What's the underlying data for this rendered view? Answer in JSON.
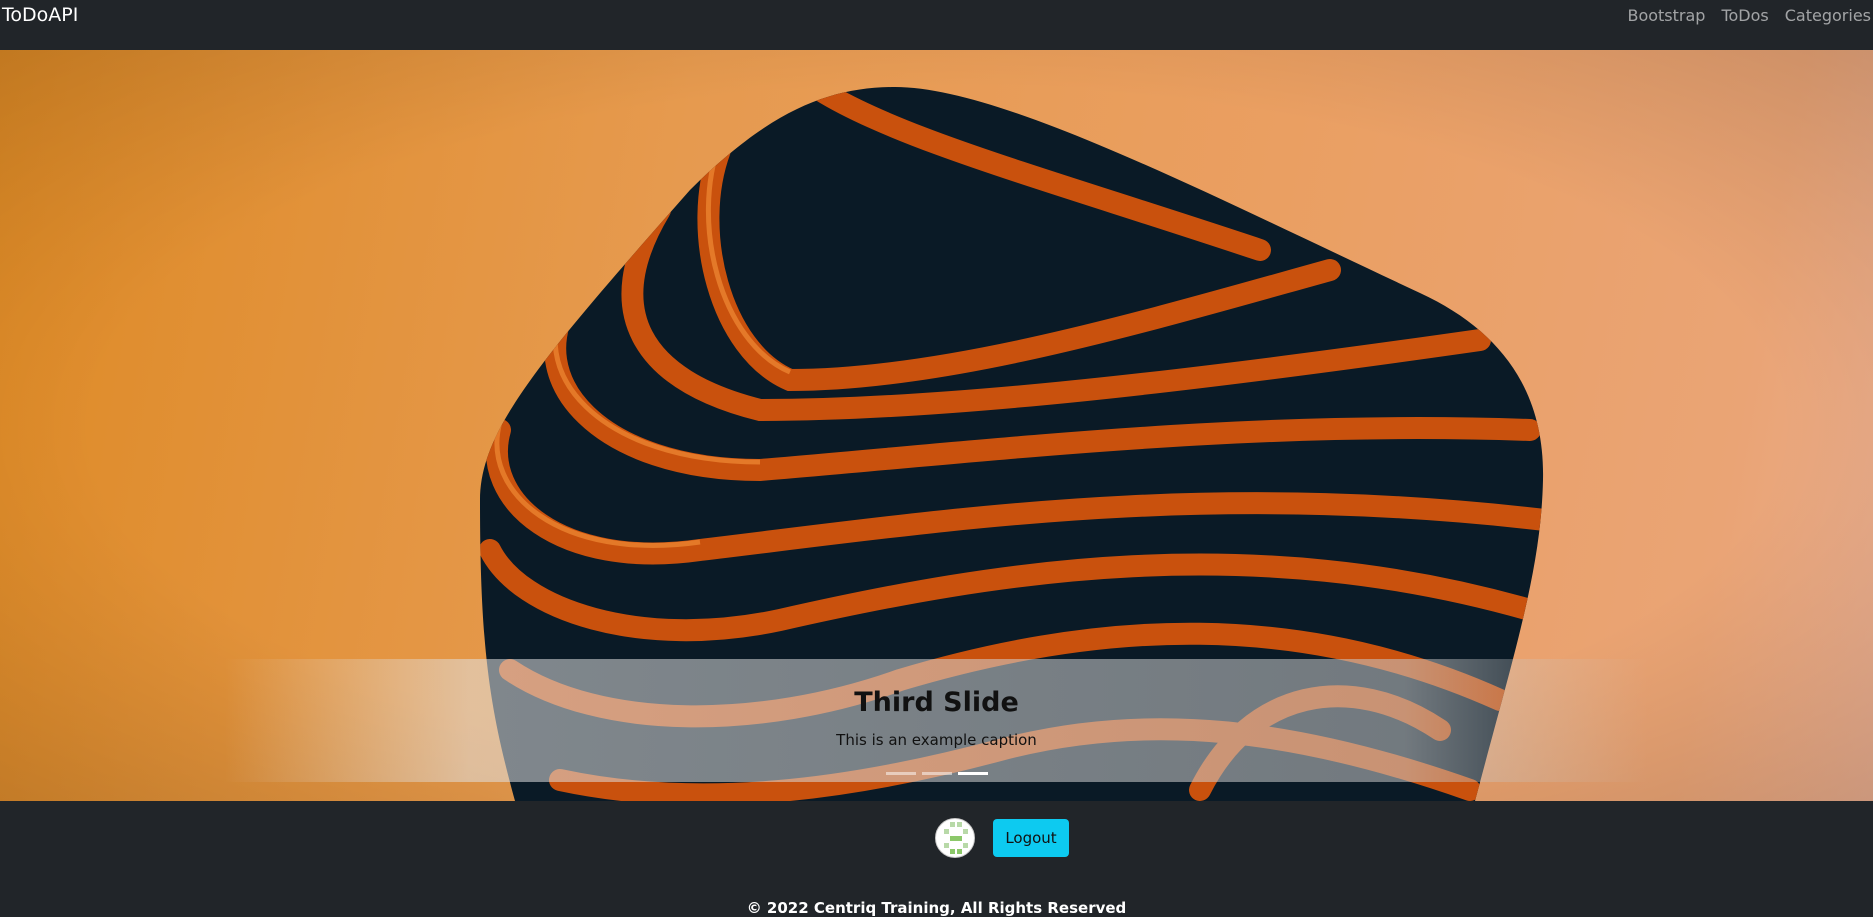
{
  "navbar": {
    "brand": "ToDoAPI",
    "links": [
      {
        "label": "Bootstrap"
      },
      {
        "label": "ToDos"
      },
      {
        "label": "Categories"
      }
    ]
  },
  "carousel": {
    "active_slide": 3,
    "slide_count": 3,
    "caption_title": "Third Slide",
    "caption_text": "This is an example caption"
  },
  "footer": {
    "logout_label": "Logout",
    "copyright": "© 2022 Centriq Training, All Rights Reserved"
  },
  "colors": {
    "navbar_bg": "#212529",
    "button_info": "#0dcaf0",
    "slide_orange": "#e69a4f",
    "shape_dark": "#0a1a26",
    "stripe_orange": "#c9510d"
  },
  "icons": {
    "avatar": "user-avatar-icon"
  }
}
